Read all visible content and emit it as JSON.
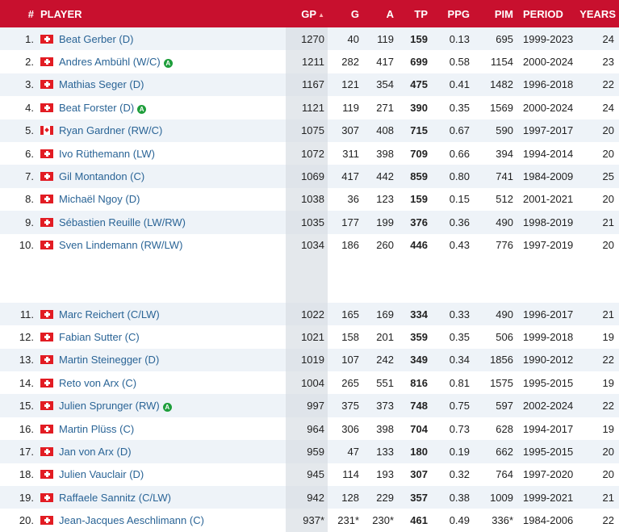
{
  "header": {
    "rank": "#",
    "player": "PLAYER",
    "gp": "GP",
    "g": "G",
    "a": "A",
    "tp": "TP",
    "ppg": "PPG",
    "pim": "PIM",
    "period": "PERIOD",
    "years": "YEARS",
    "sort_icon": "sort-ascending-icon"
  },
  "active_badge_text": "A",
  "colors": {
    "header_bg": "#c8102e",
    "link": "#2a6496",
    "alt_row": "#eef3f8",
    "active_badge": "#1e9e3b"
  },
  "rows": [
    {
      "rank": "1.",
      "flag": "switzerland-flag-icon",
      "name": "Beat Gerber (D)",
      "active": false,
      "gp": "1270",
      "g": "40",
      "a": "119",
      "tp": "159",
      "ppg": "0.13",
      "pim": "695",
      "period": "1999-2023",
      "years": "24"
    },
    {
      "rank": "2.",
      "flag": "switzerland-flag-icon",
      "name": "Andres Ambühl (W/C)",
      "active": true,
      "gp": "1211",
      "g": "282",
      "a": "417",
      "tp": "699",
      "ppg": "0.58",
      "pim": "1154",
      "period": "2000-2024",
      "years": "23"
    },
    {
      "rank": "3.",
      "flag": "switzerland-flag-icon",
      "name": "Mathias Seger (D)",
      "active": false,
      "gp": "1167",
      "g": "121",
      "a": "354",
      "tp": "475",
      "ppg": "0.41",
      "pim": "1482",
      "period": "1996-2018",
      "years": "22"
    },
    {
      "rank": "4.",
      "flag": "switzerland-flag-icon",
      "name": "Beat Forster (D)",
      "active": true,
      "gp": "1121",
      "g": "119",
      "a": "271",
      "tp": "390",
      "ppg": "0.35",
      "pim": "1569",
      "period": "2000-2024",
      "years": "24"
    },
    {
      "rank": "5.",
      "flag": "canada-flag-icon",
      "name": "Ryan Gardner (RW/C)",
      "active": false,
      "gp": "1075",
      "g": "307",
      "a": "408",
      "tp": "715",
      "ppg": "0.67",
      "pim": "590",
      "period": "1997-2017",
      "years": "20"
    },
    {
      "rank": "6.",
      "flag": "switzerland-flag-icon",
      "name": "Ivo Rüthemann (LW)",
      "active": false,
      "gp": "1072",
      "g": "311",
      "a": "398",
      "tp": "709",
      "ppg": "0.66",
      "pim": "394",
      "period": "1994-2014",
      "years": "20"
    },
    {
      "rank": "7.",
      "flag": "switzerland-flag-icon",
      "name": "Gil Montandon (C)",
      "active": false,
      "gp": "1069",
      "g": "417",
      "a": "442",
      "tp": "859",
      "ppg": "0.80",
      "pim": "741",
      "period": "1984-2009",
      "years": "25"
    },
    {
      "rank": "8.",
      "flag": "switzerland-flag-icon",
      "name": "Michaël Ngoy (D)",
      "active": false,
      "gp": "1038",
      "g": "36",
      "a": "123",
      "tp": "159",
      "ppg": "0.15",
      "pim": "512",
      "period": "2001-2021",
      "years": "20"
    },
    {
      "rank": "9.",
      "flag": "switzerland-flag-icon",
      "name": "Sébastien Reuille (LW/RW)",
      "active": false,
      "gp": "1035",
      "g": "177",
      "a": "199",
      "tp": "376",
      "ppg": "0.36",
      "pim": "490",
      "period": "1998-2019",
      "years": "21"
    },
    {
      "rank": "10.",
      "flag": "switzerland-flag-icon",
      "name": "Sven Lindemann (RW/LW)",
      "active": false,
      "gp": "1034",
      "g": "186",
      "a": "260",
      "tp": "446",
      "ppg": "0.43",
      "pim": "776",
      "period": "1997-2019",
      "years": "20"
    },
    {
      "rank": "11.",
      "flag": "switzerland-flag-icon",
      "name": "Marc Reichert (C/LW)",
      "active": false,
      "gp": "1022",
      "g": "165",
      "a": "169",
      "tp": "334",
      "ppg": "0.33",
      "pim": "490",
      "period": "1996-2017",
      "years": "21"
    },
    {
      "rank": "12.",
      "flag": "switzerland-flag-icon",
      "name": "Fabian Sutter (C)",
      "active": false,
      "gp": "1021",
      "g": "158",
      "a": "201",
      "tp": "359",
      "ppg": "0.35",
      "pim": "506",
      "period": "1999-2018",
      "years": "19"
    },
    {
      "rank": "13.",
      "flag": "switzerland-flag-icon",
      "name": "Martin Steinegger (D)",
      "active": false,
      "gp": "1019",
      "g": "107",
      "a": "242",
      "tp": "349",
      "ppg": "0.34",
      "pim": "1856",
      "period": "1990-2012",
      "years": "22"
    },
    {
      "rank": "14.",
      "flag": "switzerland-flag-icon",
      "name": "Reto von Arx (C)",
      "active": false,
      "gp": "1004",
      "g": "265",
      "a": "551",
      "tp": "816",
      "ppg": "0.81",
      "pim": "1575",
      "period": "1995-2015",
      "years": "19"
    },
    {
      "rank": "15.",
      "flag": "switzerland-flag-icon",
      "name": "Julien Sprunger (RW)",
      "active": true,
      "gp": "997",
      "g": "375",
      "a": "373",
      "tp": "748",
      "ppg": "0.75",
      "pim": "597",
      "period": "2002-2024",
      "years": "22"
    },
    {
      "rank": "16.",
      "flag": "switzerland-flag-icon",
      "name": "Martin Plüss (C)",
      "active": false,
      "gp": "964",
      "g": "306",
      "a": "398",
      "tp": "704",
      "ppg": "0.73",
      "pim": "628",
      "period": "1994-2017",
      "years": "19"
    },
    {
      "rank": "17.",
      "flag": "switzerland-flag-icon",
      "name": "Jan von Arx (D)",
      "active": false,
      "gp": "959",
      "g": "47",
      "a": "133",
      "tp": "180",
      "ppg": "0.19",
      "pim": "662",
      "period": "1995-2015",
      "years": "20"
    },
    {
      "rank": "18.",
      "flag": "switzerland-flag-icon",
      "name": "Julien Vauclair (D)",
      "active": false,
      "gp": "945",
      "g": "114",
      "a": "193",
      "tp": "307",
      "ppg": "0.32",
      "pim": "764",
      "period": "1997-2020",
      "years": "20"
    },
    {
      "rank": "19.",
      "flag": "switzerland-flag-icon",
      "name": "Raffaele Sannitz (C/LW)",
      "active": false,
      "gp": "942",
      "g": "128",
      "a": "229",
      "tp": "357",
      "ppg": "0.38",
      "pim": "1009",
      "period": "1999-2021",
      "years": "21"
    },
    {
      "rank": "20.",
      "flag": "switzerland-flag-icon",
      "name": "Jean-Jacques Aeschlimann (C)",
      "active": false,
      "gp": "937*",
      "g": "231*",
      "a": "230*",
      "tp": "461",
      "ppg": "0.49",
      "pim": "336*",
      "period": "1984-2006",
      "years": "22"
    }
  ]
}
